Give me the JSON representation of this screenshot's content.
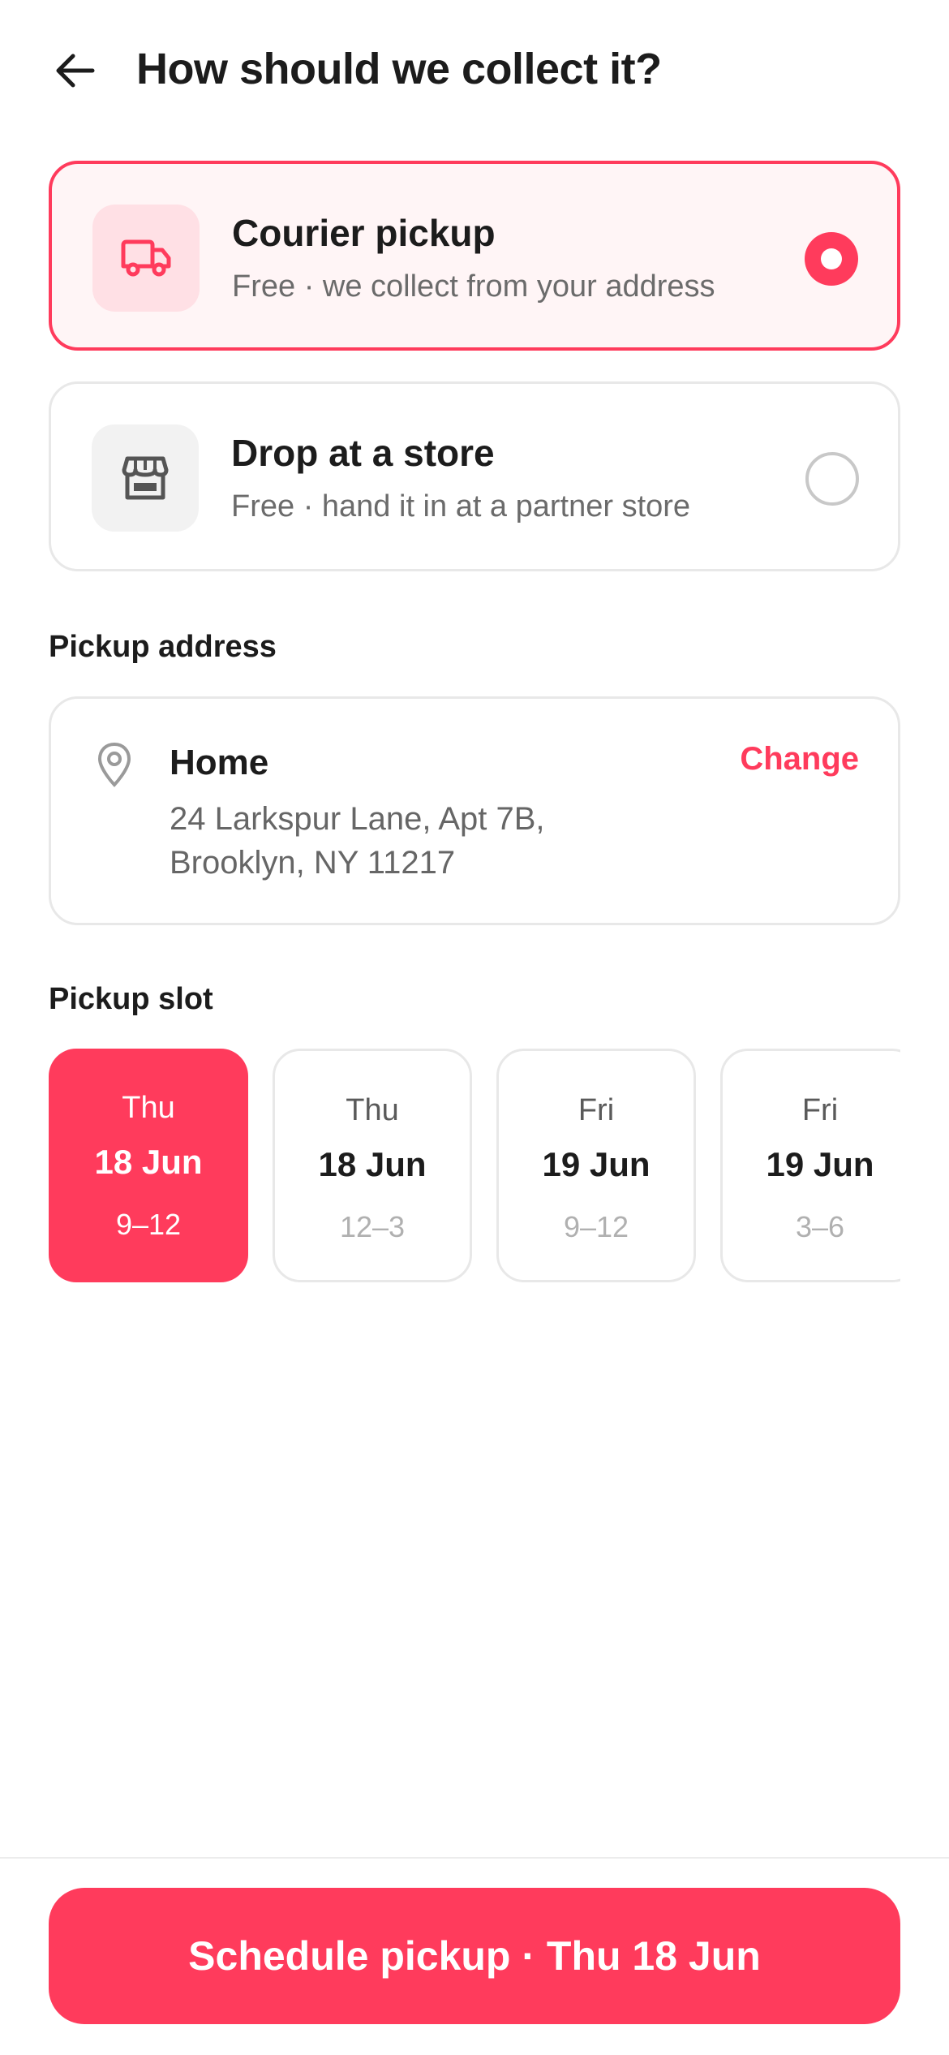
{
  "header": {
    "title": "How should we collect it?",
    "back_icon": "arrow-left-icon"
  },
  "options": [
    {
      "title": "Courier pickup",
      "subtitle": "Free · we collect from your address",
      "icon": "truck-icon",
      "selected": true
    },
    {
      "title": "Drop at a store",
      "subtitle": "Free · hand it in at a partner store",
      "icon": "storefront-icon",
      "selected": false
    }
  ],
  "address_section": {
    "label": "Pickup address",
    "name": "Home",
    "line1": "24 Larkspur Lane, Apt 7B,",
    "line2": "Brooklyn, NY 11217",
    "change_label": "Change",
    "icon": "map-pin-icon"
  },
  "slot_section": {
    "label": "Pickup slot",
    "slots": [
      {
        "day": "Thu",
        "date": "18 Jun",
        "time": "9–12",
        "selected": true
      },
      {
        "day": "Thu",
        "date": "18 Jun",
        "time": "12–3",
        "selected": false
      },
      {
        "day": "Fri",
        "date": "19 Jun",
        "time": "9–12",
        "selected": false
      },
      {
        "day": "Fri",
        "date": "19 Jun",
        "time": "3–6",
        "selected": false
      }
    ]
  },
  "cta": {
    "label": "Schedule pickup · Thu 18 Jun"
  },
  "colors": {
    "accent": "#ff3b5c",
    "accent_tint": "#fff5f6",
    "border": "#e8e8e8",
    "text": "#1c1c1c",
    "muted": "#6b6b6b"
  }
}
